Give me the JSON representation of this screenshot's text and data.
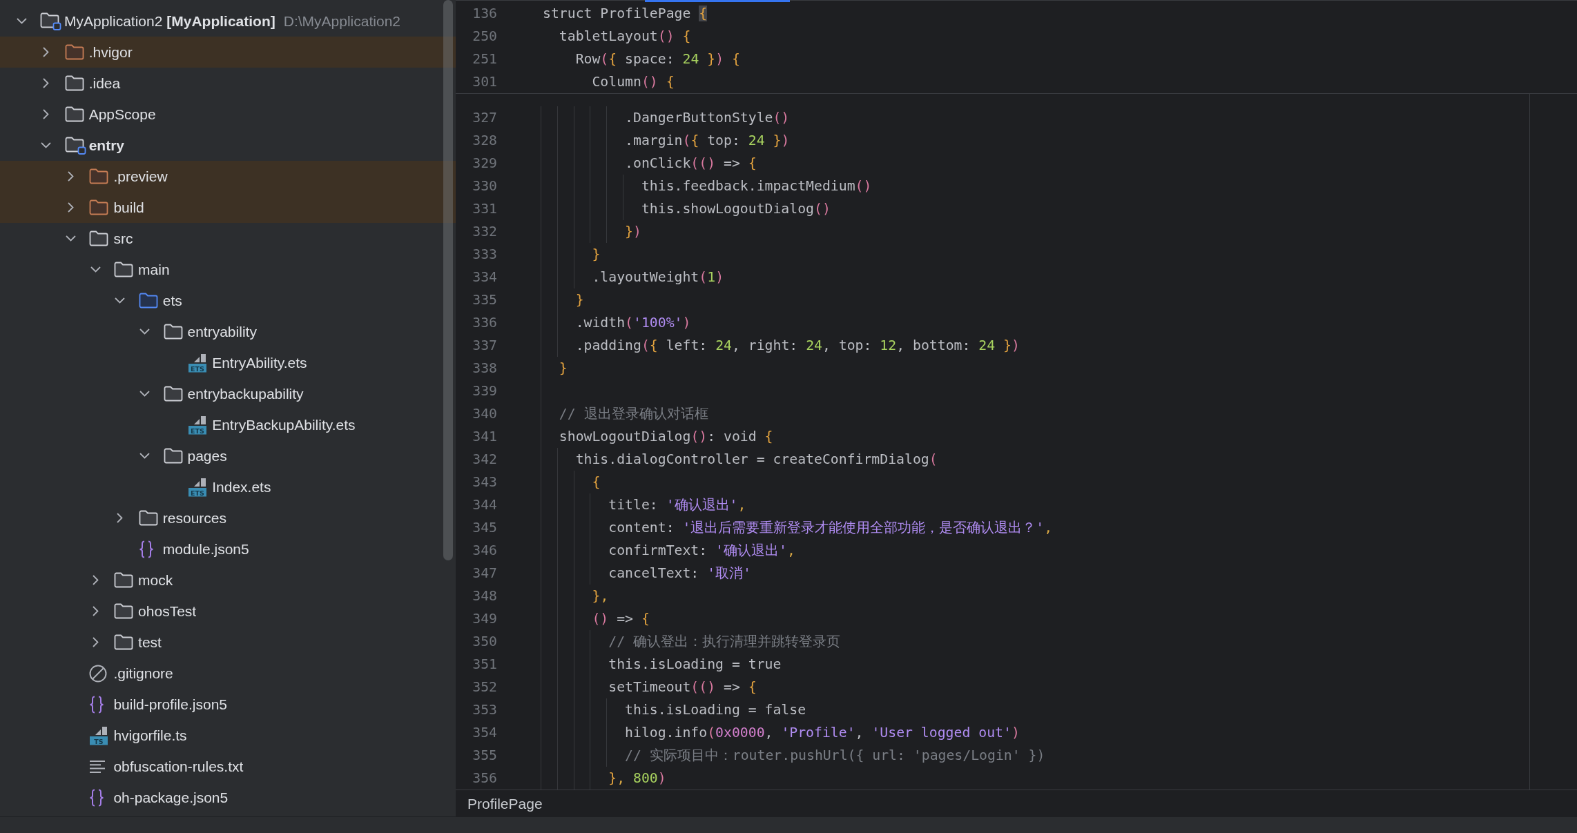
{
  "project_tree": {
    "root": {
      "label": "MyApplication2 **[MyApplication]**",
      "path": "D:\\MyApplication2",
      "kind": "project",
      "expanded": true,
      "children": [
        {
          "label": ".hvigor",
          "kind": "excluded_folder",
          "expanded": false
        },
        {
          "label": ".idea",
          "kind": "folder",
          "expanded": false
        },
        {
          "label": "AppScope",
          "kind": "folder",
          "expanded": false
        },
        {
          "label": "entry",
          "kind": "module",
          "expanded": true,
          "children": [
            {
              "label": ".preview",
              "kind": "excluded_folder",
              "expanded": false
            },
            {
              "label": "build",
              "kind": "excluded_folder",
              "expanded": false
            },
            {
              "label": "src",
              "kind": "folder",
              "expanded": true,
              "children": [
                {
                  "label": "main",
                  "kind": "folder",
                  "expanded": true,
                  "children": [
                    {
                      "label": "ets",
                      "kind": "source_folder",
                      "expanded": true,
                      "children": [
                        {
                          "label": "entryability",
                          "kind": "folder",
                          "expanded": true,
                          "children": [
                            {
                              "label": "EntryAbility.ets",
                              "kind": "ets_file",
                              "badge": "ETS"
                            }
                          ]
                        },
                        {
                          "label": "entrybackupability",
                          "kind": "folder",
                          "expanded": true,
                          "children": [
                            {
                              "label": "EntryBackupAbility.ets",
                              "kind": "ets_file",
                              "badge": "ETS"
                            }
                          ]
                        },
                        {
                          "label": "pages",
                          "kind": "folder",
                          "expanded": true,
                          "children": [
                            {
                              "label": "Index.ets",
                              "kind": "ets_file",
                              "badge": "ETS"
                            }
                          ]
                        }
                      ]
                    },
                    {
                      "label": "resources",
                      "kind": "folder",
                      "expanded": false
                    },
                    {
                      "label": "module.json5",
                      "kind": "json_file"
                    }
                  ]
                },
                {
                  "label": "mock",
                  "kind": "folder",
                  "expanded": false
                },
                {
                  "label": "ohosTest",
                  "kind": "folder",
                  "expanded": false
                },
                {
                  "label": "test",
                  "kind": "folder",
                  "expanded": false
                }
              ]
            },
            {
              "label": ".gitignore",
              "kind": "ignore_file"
            },
            {
              "label": "build-profile.json5",
              "kind": "json_file"
            },
            {
              "label": "hvigorfile.ts",
              "kind": "ts_file",
              "badge": "TS"
            },
            {
              "label": "obfuscation-rules.txt",
              "kind": "text_file"
            },
            {
              "label": "oh-package.json5",
              "kind": "json_file"
            }
          ]
        }
      ]
    }
  },
  "editor": {
    "sticky_lines": [
      {
        "number": "136",
        "tokens": [
          {
            "kind": "plain",
            "text": "struct ProfilePage "
          },
          {
            "kind": "match",
            "text": "{"
          }
        ]
      },
      {
        "number": "250",
        "tokens": [
          {
            "kind": "plain",
            "text": "  tabletLayout"
          },
          {
            "kind": "paren",
            "text": "()"
          },
          {
            "kind": "brace",
            "text": " {"
          }
        ]
      },
      {
        "number": "251",
        "tokens": [
          {
            "kind": "plain",
            "text": "    Row"
          },
          {
            "kind": "paren",
            "text": "("
          },
          {
            "kind": "brace",
            "text": "{"
          },
          {
            "kind": "plain",
            "text": " space: "
          },
          {
            "kind": "number",
            "text": "24"
          },
          {
            "kind": "brace",
            "text": " }"
          },
          {
            "kind": "paren",
            "text": ")"
          },
          {
            "kind": "brace",
            "text": " {"
          }
        ]
      },
      {
        "number": "301",
        "tokens": [
          {
            "kind": "plain",
            "text": "      Column"
          },
          {
            "kind": "paren",
            "text": "()"
          },
          {
            "kind": "brace",
            "text": " {"
          }
        ]
      }
    ],
    "lines": [
      {
        "number": "327",
        "tokens": [
          {
            "kind": "plain",
            "text": "          .DangerButtonStyle"
          },
          {
            "kind": "paren",
            "text": "()"
          }
        ]
      },
      {
        "number": "328",
        "tokens": [
          {
            "kind": "plain",
            "text": "          .margin"
          },
          {
            "kind": "paren",
            "text": "("
          },
          {
            "kind": "brace",
            "text": "{"
          },
          {
            "kind": "plain",
            "text": " top: "
          },
          {
            "kind": "number",
            "text": "24"
          },
          {
            "kind": "brace",
            "text": " }"
          },
          {
            "kind": "paren",
            "text": ")"
          }
        ]
      },
      {
        "number": "329",
        "tokens": [
          {
            "kind": "plain",
            "text": "          .onClick"
          },
          {
            "kind": "paren",
            "text": "(()"
          },
          {
            "kind": "plain",
            "text": " => "
          },
          {
            "kind": "brace",
            "text": "{"
          }
        ]
      },
      {
        "number": "330",
        "tokens": [
          {
            "kind": "plain",
            "text": "            this.feedback.impactMedium"
          },
          {
            "kind": "paren",
            "text": "()"
          }
        ]
      },
      {
        "number": "331",
        "tokens": [
          {
            "kind": "plain",
            "text": "            this.showLogoutDialog"
          },
          {
            "kind": "paren",
            "text": "()"
          }
        ]
      },
      {
        "number": "332",
        "tokens": [
          {
            "kind": "brace",
            "text": "          }"
          },
          {
            "kind": "paren",
            "text": ")"
          }
        ]
      },
      {
        "number": "333",
        "tokens": [
          {
            "kind": "brace",
            "text": "      }"
          }
        ]
      },
      {
        "number": "334",
        "tokens": [
          {
            "kind": "plain",
            "text": "      .layoutWeight"
          },
          {
            "kind": "paren",
            "text": "("
          },
          {
            "kind": "number",
            "text": "1"
          },
          {
            "kind": "paren",
            "text": ")"
          }
        ]
      },
      {
        "number": "335",
        "tokens": [
          {
            "kind": "brace",
            "text": "    }"
          }
        ]
      },
      {
        "number": "336",
        "tokens": [
          {
            "kind": "plain",
            "text": "    .width"
          },
          {
            "kind": "paren",
            "text": "("
          },
          {
            "kind": "string",
            "text": "'100%'"
          },
          {
            "kind": "paren",
            "text": ")"
          }
        ]
      },
      {
        "number": "337",
        "tokens": [
          {
            "kind": "plain",
            "text": "    .padding"
          },
          {
            "kind": "paren",
            "text": "("
          },
          {
            "kind": "brace",
            "text": "{"
          },
          {
            "kind": "plain",
            "text": " left: "
          },
          {
            "kind": "number",
            "text": "24"
          },
          {
            "kind": "plain",
            "text": ", right: "
          },
          {
            "kind": "number",
            "text": "24"
          },
          {
            "kind": "plain",
            "text": ", top: "
          },
          {
            "kind": "number",
            "text": "12"
          },
          {
            "kind": "plain",
            "text": ", bottom: "
          },
          {
            "kind": "number",
            "text": "24"
          },
          {
            "kind": "brace",
            "text": " }"
          },
          {
            "kind": "paren",
            "text": ")"
          }
        ]
      },
      {
        "number": "338",
        "tokens": [
          {
            "kind": "brace",
            "text": "  }"
          }
        ]
      },
      {
        "number": "339"
      },
      {
        "number": "340",
        "tokens": [
          {
            "kind": "comment",
            "text": "  // 退出登录确认对话框"
          }
        ]
      },
      {
        "number": "341",
        "tokens": [
          {
            "kind": "plain",
            "text": "  showLogoutDialog"
          },
          {
            "kind": "paren",
            "text": "()"
          },
          {
            "kind": "plain",
            "text": ": void "
          },
          {
            "kind": "brace",
            "text": "{"
          }
        ]
      },
      {
        "number": "342",
        "tokens": [
          {
            "kind": "plain",
            "text": "    this.dialogController = createConfirmDialog"
          },
          {
            "kind": "paren",
            "text": "("
          }
        ]
      },
      {
        "number": "343",
        "tokens": [
          {
            "kind": "brace",
            "text": "      {"
          }
        ]
      },
      {
        "number": "344",
        "tokens": [
          {
            "kind": "plain",
            "text": "        title: "
          },
          {
            "kind": "string",
            "text": "'确认退出'"
          },
          {
            "kind": "comma",
            "text": ","
          }
        ]
      },
      {
        "number": "345",
        "tokens": [
          {
            "kind": "plain",
            "text": "        content: "
          },
          {
            "kind": "string",
            "text": "'退出后需要重新登录才能使用全部功能，是否确认退出？'"
          },
          {
            "kind": "comma",
            "text": ","
          }
        ]
      },
      {
        "number": "346",
        "tokens": [
          {
            "kind": "plain",
            "text": "        confirmText: "
          },
          {
            "kind": "string",
            "text": "'确认退出'"
          },
          {
            "kind": "comma",
            "text": ","
          }
        ]
      },
      {
        "number": "347",
        "tokens": [
          {
            "kind": "plain",
            "text": "        cancelText: "
          },
          {
            "kind": "string",
            "text": "'取消'"
          }
        ]
      },
      {
        "number": "348",
        "tokens": [
          {
            "kind": "brace",
            "text": "      }"
          },
          {
            "kind": "comma",
            "text": ","
          }
        ]
      },
      {
        "number": "349",
        "tokens": [
          {
            "kind": "paren",
            "text": "      ()"
          },
          {
            "kind": "plain",
            "text": " => "
          },
          {
            "kind": "brace",
            "text": "{"
          }
        ]
      },
      {
        "number": "350",
        "tokens": [
          {
            "kind": "comment",
            "text": "        // 确认登出：执行清理并跳转登录页"
          }
        ]
      },
      {
        "number": "351",
        "tokens": [
          {
            "kind": "plain",
            "text": "        this.isLoading = true"
          }
        ]
      },
      {
        "number": "352",
        "tokens": [
          {
            "kind": "plain",
            "text": "        setTimeout"
          },
          {
            "kind": "paren",
            "text": "(()"
          },
          {
            "kind": "plain",
            "text": " => "
          },
          {
            "kind": "brace",
            "text": "{"
          }
        ]
      },
      {
        "number": "353",
        "tokens": [
          {
            "kind": "plain",
            "text": "          this.isLoading = false"
          }
        ]
      },
      {
        "number": "354",
        "tokens": [
          {
            "kind": "plain",
            "text": "          hilog.info"
          },
          {
            "kind": "paren",
            "text": "("
          },
          {
            "kind": "hex",
            "text": "0x0000"
          },
          {
            "kind": "plain",
            "text": ", "
          },
          {
            "kind": "string",
            "text": "'Profile'"
          },
          {
            "kind": "plain",
            "text": ", "
          },
          {
            "kind": "string",
            "text": "'User logged out'"
          },
          {
            "kind": "paren",
            "text": ")"
          }
        ]
      },
      {
        "number": "355",
        "tokens": [
          {
            "kind": "comment",
            "text": "          // 实际项目中：router.pushUrl({ url: 'pages/Login' })"
          }
        ]
      },
      {
        "number": "356",
        "tokens": [
          {
            "kind": "brace",
            "text": "        }"
          },
          {
            "kind": "comma",
            "text": ","
          },
          {
            "kind": "number",
            "text": " 800"
          },
          {
            "kind": "paren",
            "text": ")"
          }
        ]
      }
    ],
    "breadcrumb": [
      "ProfilePage"
    ]
  }
}
